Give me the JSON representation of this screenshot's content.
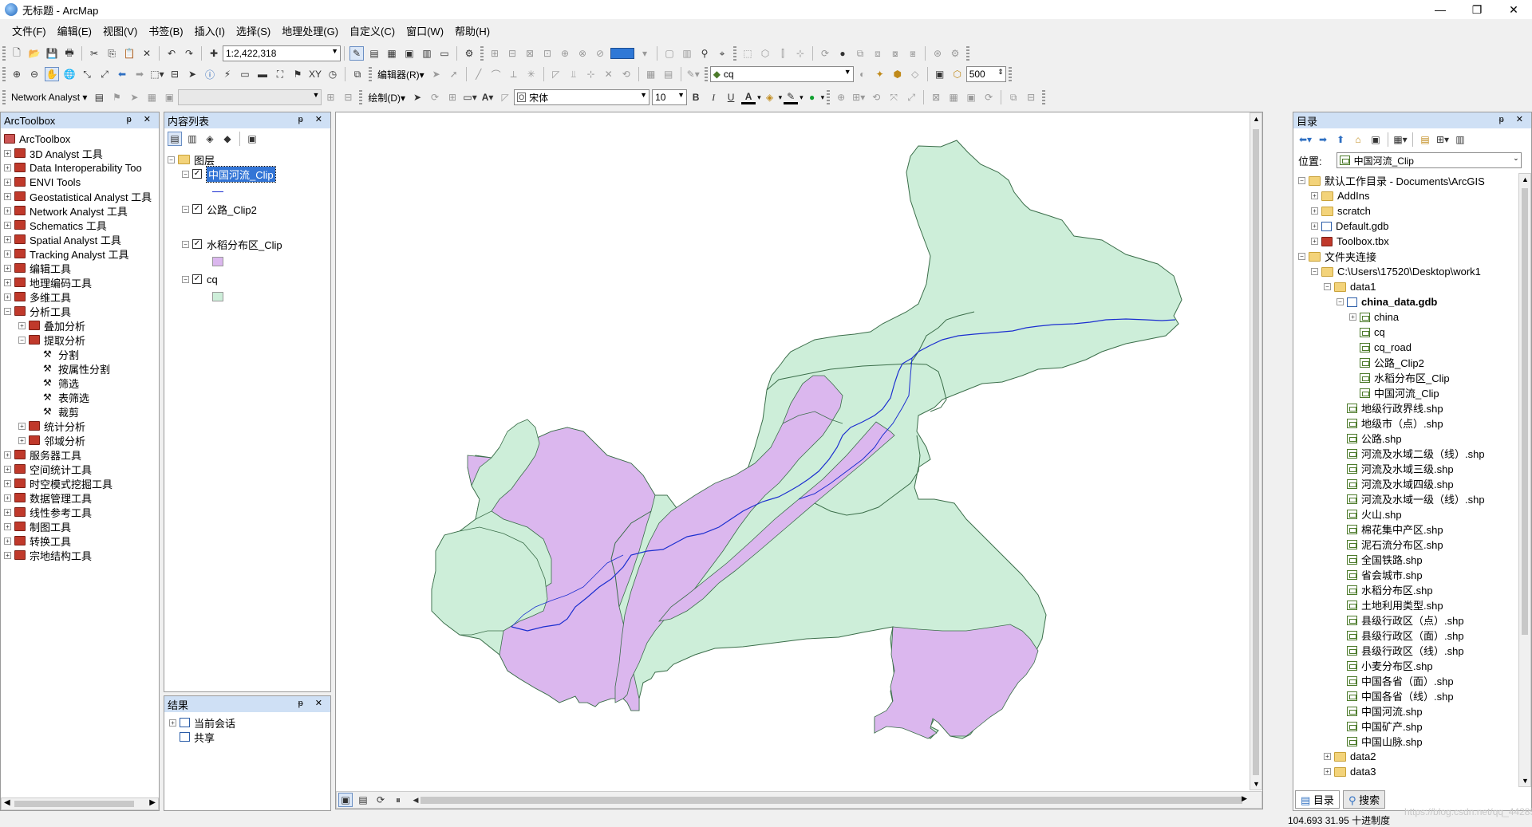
{
  "window": {
    "title": "无标题 - ArcMap",
    "min": "—",
    "max": "❐",
    "close": "✕"
  },
  "menu": [
    "文件(F)",
    "编辑(E)",
    "视图(V)",
    "书签(B)",
    "插入(I)",
    "选择(S)",
    "地理处理(G)",
    "自定义(C)",
    "窗口(W)",
    "帮助(H)"
  ],
  "toolbar": {
    "scale": "1:2,422,318",
    "layer_combo": "cq",
    "snap_value": "500",
    "editor_label": "编辑器(R)▾",
    "network_label": "Network Analyst ▾",
    "draw_label": "绘制(D)▾",
    "font_name": "宋体",
    "font_size": "10",
    "bold": "B",
    "italic": "I",
    "underline": "U"
  },
  "arctoolbox": {
    "title": "ArcToolbox",
    "pins": "ᵽ ✕",
    "root": "ArcToolbox",
    "items": [
      {
        "label": "3D Analyst 工具",
        "lvl": 0,
        "type": "tbx",
        "exp": "+"
      },
      {
        "label": "Data Interoperability Too",
        "lvl": 0,
        "type": "tbx",
        "exp": "+"
      },
      {
        "label": "ENVI Tools",
        "lvl": 0,
        "type": "tbx",
        "exp": "+"
      },
      {
        "label": "Geostatistical Analyst 工具",
        "lvl": 0,
        "type": "tbx",
        "exp": "+"
      },
      {
        "label": "Network Analyst 工具",
        "lvl": 0,
        "type": "tbx",
        "exp": "+"
      },
      {
        "label": "Schematics 工具",
        "lvl": 0,
        "type": "tbx",
        "exp": "+"
      },
      {
        "label": "Spatial Analyst 工具",
        "lvl": 0,
        "type": "tbx",
        "exp": "+"
      },
      {
        "label": "Tracking Analyst 工具",
        "lvl": 0,
        "type": "tbx",
        "exp": "+"
      },
      {
        "label": "编辑工具",
        "lvl": 0,
        "type": "tbx",
        "exp": "+"
      },
      {
        "label": "地理编码工具",
        "lvl": 0,
        "type": "tbx",
        "exp": "+"
      },
      {
        "label": "多维工具",
        "lvl": 0,
        "type": "tbx",
        "exp": "+"
      },
      {
        "label": "分析工具",
        "lvl": 0,
        "type": "tbx",
        "exp": "−"
      },
      {
        "label": "叠加分析",
        "lvl": 1,
        "type": "tbx",
        "exp": "+"
      },
      {
        "label": "提取分析",
        "lvl": 1,
        "type": "tbx",
        "exp": "−"
      },
      {
        "label": "分割",
        "lvl": 2,
        "type": "hammer",
        "exp": ""
      },
      {
        "label": "按属性分割",
        "lvl": 2,
        "type": "hammer",
        "exp": ""
      },
      {
        "label": "筛选",
        "lvl": 2,
        "type": "hammer",
        "exp": ""
      },
      {
        "label": "表筛选",
        "lvl": 2,
        "type": "hammer",
        "exp": ""
      },
      {
        "label": "裁剪",
        "lvl": 2,
        "type": "hammer",
        "exp": ""
      },
      {
        "label": "统计分析",
        "lvl": 1,
        "type": "tbx",
        "exp": "+"
      },
      {
        "label": "邻域分析",
        "lvl": 1,
        "type": "tbx",
        "exp": "+"
      },
      {
        "label": "服务器工具",
        "lvl": 0,
        "type": "tbx",
        "exp": "+"
      },
      {
        "label": "空间统计工具",
        "lvl": 0,
        "type": "tbx",
        "exp": "+"
      },
      {
        "label": "时空模式挖掘工具",
        "lvl": 0,
        "type": "tbx",
        "exp": "+"
      },
      {
        "label": "数据管理工具",
        "lvl": 0,
        "type": "tbx",
        "exp": "+"
      },
      {
        "label": "线性参考工具",
        "lvl": 0,
        "type": "tbx",
        "exp": "+"
      },
      {
        "label": "制图工具",
        "lvl": 0,
        "type": "tbx",
        "exp": "+"
      },
      {
        "label": "转换工具",
        "lvl": 0,
        "type": "tbx",
        "exp": "+"
      },
      {
        "label": "宗地结构工具",
        "lvl": 0,
        "type": "tbx",
        "exp": "+"
      }
    ]
  },
  "toc": {
    "title": "内容列表",
    "root": "图层",
    "layers": [
      {
        "name": "中国河流_Clip",
        "selected": true,
        "symbol": "line",
        "color": "#1c2fd0"
      },
      {
        "name": "公路_Clip2",
        "selected": false,
        "symbol": "none",
        "color": ""
      },
      {
        "name": "水稻分布区_Clip",
        "selected": false,
        "symbol": "fill",
        "color": "#dbb7ee"
      },
      {
        "name": "cq",
        "selected": false,
        "symbol": "fill",
        "color": "#cdeed9"
      }
    ]
  },
  "results": {
    "title": "结果",
    "items": [
      "当前会话",
      "共享"
    ]
  },
  "catalog": {
    "title": "目录",
    "location_label": "位置:",
    "location_value": "中国河流_Clip",
    "items": [
      {
        "label": "默认工作目录 - Documents\\ArcGIS",
        "lvl": 0,
        "type": "folder",
        "exp": "−"
      },
      {
        "label": "AddIns",
        "lvl": 1,
        "type": "folder",
        "exp": "+"
      },
      {
        "label": "scratch",
        "lvl": 1,
        "type": "folder",
        "exp": "+"
      },
      {
        "label": "Default.gdb",
        "lvl": 1,
        "type": "gdb",
        "exp": "+"
      },
      {
        "label": "Toolbox.tbx",
        "lvl": 1,
        "type": "tbx",
        "exp": "+"
      },
      {
        "label": "文件夹连接",
        "lvl": 0,
        "type": "folder",
        "exp": "−"
      },
      {
        "label": "C:\\Users\\17520\\Desktop\\work1",
        "lvl": 1,
        "type": "folder",
        "exp": "−"
      },
      {
        "label": "data1",
        "lvl": 2,
        "type": "folder",
        "exp": "−"
      },
      {
        "label": "china_data.gdb",
        "lvl": 3,
        "type": "gdb",
        "exp": "−",
        "bold": true
      },
      {
        "label": "china",
        "lvl": 4,
        "type": "fc",
        "exp": "+"
      },
      {
        "label": "cq",
        "lvl": 4,
        "type": "fc",
        "exp": ""
      },
      {
        "label": "cq_road",
        "lvl": 4,
        "type": "fc",
        "exp": ""
      },
      {
        "label": "公路_Clip2",
        "lvl": 4,
        "type": "fc",
        "exp": ""
      },
      {
        "label": "水稻分布区_Clip",
        "lvl": 4,
        "type": "fc",
        "exp": ""
      },
      {
        "label": "中国河流_Clip",
        "lvl": 4,
        "type": "fc",
        "exp": ""
      },
      {
        "label": "地级行政界线.shp",
        "lvl": 3,
        "type": "fc",
        "exp": ""
      },
      {
        "label": "地级市（点）.shp",
        "lvl": 3,
        "type": "fc",
        "exp": ""
      },
      {
        "label": "公路.shp",
        "lvl": 3,
        "type": "fc",
        "exp": ""
      },
      {
        "label": "河流及水域二级（线）.shp",
        "lvl": 3,
        "type": "fc",
        "exp": ""
      },
      {
        "label": "河流及水域三级.shp",
        "lvl": 3,
        "type": "fc",
        "exp": ""
      },
      {
        "label": "河流及水域四级.shp",
        "lvl": 3,
        "type": "fc",
        "exp": ""
      },
      {
        "label": "河流及水域一级（线）.shp",
        "lvl": 3,
        "type": "fc",
        "exp": ""
      },
      {
        "label": "火山.shp",
        "lvl": 3,
        "type": "fc",
        "exp": ""
      },
      {
        "label": "棉花集中产区.shp",
        "lvl": 3,
        "type": "fc",
        "exp": ""
      },
      {
        "label": "泥石流分布区.shp",
        "lvl": 3,
        "type": "fc",
        "exp": ""
      },
      {
        "label": "全国铁路.shp",
        "lvl": 3,
        "type": "fc",
        "exp": ""
      },
      {
        "label": "省会城市.shp",
        "lvl": 3,
        "type": "fc",
        "exp": ""
      },
      {
        "label": "水稻分布区.shp",
        "lvl": 3,
        "type": "fc",
        "exp": ""
      },
      {
        "label": "土地利用类型.shp",
        "lvl": 3,
        "type": "fc",
        "exp": ""
      },
      {
        "label": "县级行政区（点）.shp",
        "lvl": 3,
        "type": "fc",
        "exp": ""
      },
      {
        "label": "县级行政区（面）.shp",
        "lvl": 3,
        "type": "fc",
        "exp": ""
      },
      {
        "label": "县级行政区（线）.shp",
        "lvl": 3,
        "type": "fc",
        "exp": ""
      },
      {
        "label": "小麦分布区.shp",
        "lvl": 3,
        "type": "fc",
        "exp": ""
      },
      {
        "label": "中国各省（面）.shp",
        "lvl": 3,
        "type": "fc",
        "exp": ""
      },
      {
        "label": "中国各省（线）.shp",
        "lvl": 3,
        "type": "fc",
        "exp": ""
      },
      {
        "label": "中国河流.shp",
        "lvl": 3,
        "type": "fc",
        "exp": ""
      },
      {
        "label": "中国矿产.shp",
        "lvl": 3,
        "type": "fc",
        "exp": ""
      },
      {
        "label": "中国山脉.shp",
        "lvl": 3,
        "type": "fc",
        "exp": ""
      },
      {
        "label": "data2",
        "lvl": 2,
        "type": "folder",
        "exp": "+"
      },
      {
        "label": "data3",
        "lvl": 2,
        "type": "folder",
        "exp": "+"
      }
    ],
    "tabs": [
      "目录",
      "搜索"
    ]
  },
  "status": {
    "coords": "104.693  31.95 十进制度",
    "watermark": "https://blog.csdn.net/qq_44285092"
  },
  "colors": {
    "region_fill": "#cdeed9",
    "rice_fill": "#dbb7ee",
    "river": "#1c2fd0",
    "boundary": "#3b6e4a",
    "header": "#cfe0f5"
  }
}
